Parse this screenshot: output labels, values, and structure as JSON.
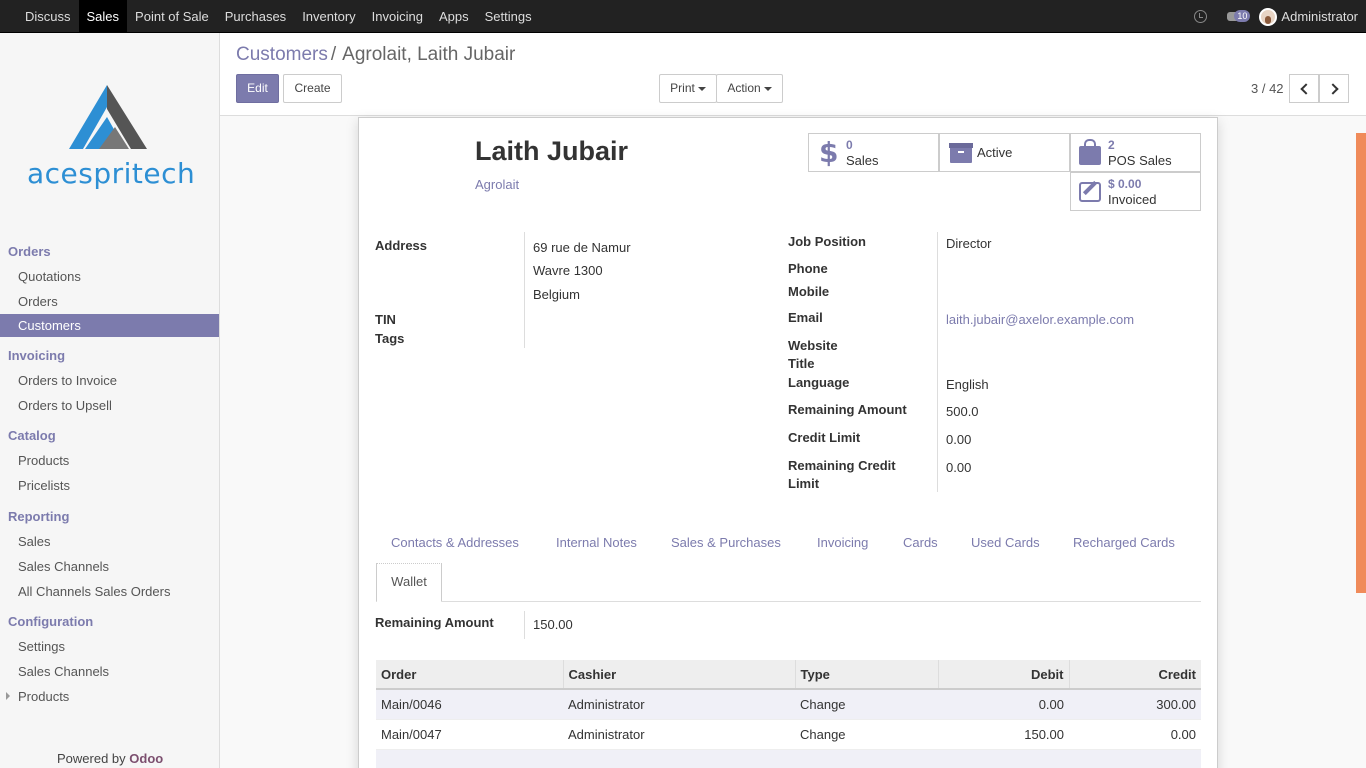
{
  "topbar": {
    "menu": [
      "Discuss",
      "Sales",
      "Point of Sale",
      "Purchases",
      "Inventory",
      "Invoicing",
      "Apps",
      "Settings"
    ],
    "active_menu": "Sales",
    "chat_count": "10",
    "user": "Administrator"
  },
  "sidebar": {
    "logo_text": "acespritech",
    "sections": [
      {
        "title": "Orders",
        "items": [
          "Quotations",
          "Orders",
          "Customers"
        ]
      },
      {
        "title": "Invoicing",
        "items": [
          "Orders to Invoice",
          "Orders to Upsell"
        ]
      },
      {
        "title": "Catalog",
        "items": [
          "Products",
          "Pricelists"
        ]
      },
      {
        "title": "Reporting",
        "items": [
          "Sales",
          "Sales Channels",
          "All Channels Sales Orders"
        ]
      },
      {
        "title": "Configuration",
        "items": [
          "Settings",
          "Sales Channels",
          "Products"
        ]
      }
    ],
    "active_item": "Customers",
    "powered_by": "Powered by",
    "powered_brand": "Odoo"
  },
  "breadcrumb": {
    "parent": "Customers",
    "sep": "/",
    "current": "Agrolait, Laith Jubair"
  },
  "buttons": {
    "edit": "Edit",
    "create": "Create",
    "print": "Print",
    "action": "Action"
  },
  "pager": {
    "text": "3 / 42"
  },
  "partner": {
    "name": "Laith Jubair",
    "company": "Agrolait"
  },
  "smart_buttons": {
    "sales": {
      "count": "0",
      "label": "Sales"
    },
    "active": {
      "label": "Active"
    },
    "pos": {
      "count": "2",
      "label": "POS Sales"
    },
    "invoiced": {
      "amount": "$ 0.00",
      "label": "Invoiced"
    }
  },
  "fields_left": {
    "address_label": "Address",
    "address_lines": [
      "69 rue de Namur",
      "Wavre 1300",
      "Belgium"
    ],
    "tin_label": "TIN",
    "tags_label": "Tags"
  },
  "fields_right": {
    "job_label": "Job Position",
    "job": "Director",
    "phone_label": "Phone",
    "mobile_label": "Mobile",
    "email_label": "Email",
    "email": "laith.jubair@axelor.example.com",
    "website_label": "Website",
    "title_label": "Title",
    "language_label": "Language",
    "language": "English",
    "remaining_label": "Remaining Amount",
    "remaining": "500.0",
    "credit_label": "Credit Limit",
    "credit": "0.00",
    "remaining_credit_label_1": "Remaining Credit",
    "remaining_credit_label_2": "Limit",
    "remaining_credit": "0.00"
  },
  "tabs": [
    "Contacts & Addresses",
    "Internal Notes",
    "Sales & Purchases",
    "Invoicing",
    "Cards",
    "Used Cards",
    "Recharged Cards",
    "Wallet"
  ],
  "wallet": {
    "remaining_label": "Remaining Amount",
    "remaining": "150.00",
    "columns": [
      "Order",
      "Cashier",
      "Type",
      "Debit",
      "Credit"
    ],
    "rows": [
      [
        "Main/0046",
        "Administrator",
        "Change",
        "0.00",
        "300.00"
      ],
      [
        "Main/0047",
        "Administrator",
        "Change",
        "150.00",
        "0.00"
      ]
    ]
  }
}
